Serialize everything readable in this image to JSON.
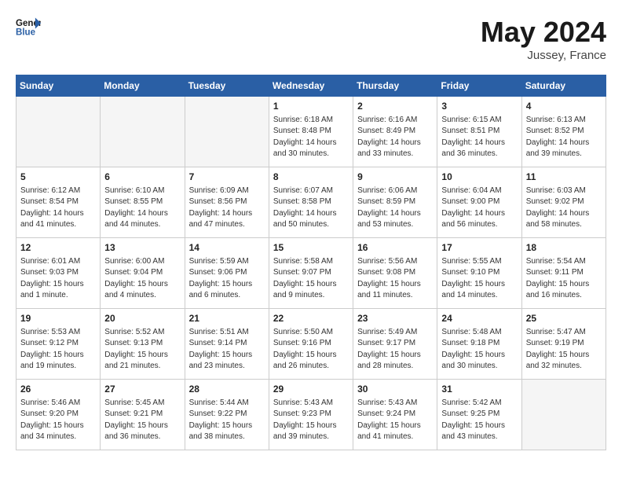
{
  "header": {
    "logo_general": "General",
    "logo_blue": "Blue",
    "month": "May 2024",
    "location": "Jussey, France"
  },
  "days_of_week": [
    "Sunday",
    "Monday",
    "Tuesday",
    "Wednesday",
    "Thursday",
    "Friday",
    "Saturday"
  ],
  "weeks": [
    [
      {
        "day": "",
        "data": ""
      },
      {
        "day": "",
        "data": ""
      },
      {
        "day": "",
        "data": ""
      },
      {
        "day": "1",
        "data": "Sunrise: 6:18 AM\nSunset: 8:48 PM\nDaylight: 14 hours\nand 30 minutes."
      },
      {
        "day": "2",
        "data": "Sunrise: 6:16 AM\nSunset: 8:49 PM\nDaylight: 14 hours\nand 33 minutes."
      },
      {
        "day": "3",
        "data": "Sunrise: 6:15 AM\nSunset: 8:51 PM\nDaylight: 14 hours\nand 36 minutes."
      },
      {
        "day": "4",
        "data": "Sunrise: 6:13 AM\nSunset: 8:52 PM\nDaylight: 14 hours\nand 39 minutes."
      }
    ],
    [
      {
        "day": "5",
        "data": "Sunrise: 6:12 AM\nSunset: 8:54 PM\nDaylight: 14 hours\nand 41 minutes."
      },
      {
        "day": "6",
        "data": "Sunrise: 6:10 AM\nSunset: 8:55 PM\nDaylight: 14 hours\nand 44 minutes."
      },
      {
        "day": "7",
        "data": "Sunrise: 6:09 AM\nSunset: 8:56 PM\nDaylight: 14 hours\nand 47 minutes."
      },
      {
        "day": "8",
        "data": "Sunrise: 6:07 AM\nSunset: 8:58 PM\nDaylight: 14 hours\nand 50 minutes."
      },
      {
        "day": "9",
        "data": "Sunrise: 6:06 AM\nSunset: 8:59 PM\nDaylight: 14 hours\nand 53 minutes."
      },
      {
        "day": "10",
        "data": "Sunrise: 6:04 AM\nSunset: 9:00 PM\nDaylight: 14 hours\nand 56 minutes."
      },
      {
        "day": "11",
        "data": "Sunrise: 6:03 AM\nSunset: 9:02 PM\nDaylight: 14 hours\nand 58 minutes."
      }
    ],
    [
      {
        "day": "12",
        "data": "Sunrise: 6:01 AM\nSunset: 9:03 PM\nDaylight: 15 hours\nand 1 minute."
      },
      {
        "day": "13",
        "data": "Sunrise: 6:00 AM\nSunset: 9:04 PM\nDaylight: 15 hours\nand 4 minutes."
      },
      {
        "day": "14",
        "data": "Sunrise: 5:59 AM\nSunset: 9:06 PM\nDaylight: 15 hours\nand 6 minutes."
      },
      {
        "day": "15",
        "data": "Sunrise: 5:58 AM\nSunset: 9:07 PM\nDaylight: 15 hours\nand 9 minutes."
      },
      {
        "day": "16",
        "data": "Sunrise: 5:56 AM\nSunset: 9:08 PM\nDaylight: 15 hours\nand 11 minutes."
      },
      {
        "day": "17",
        "data": "Sunrise: 5:55 AM\nSunset: 9:10 PM\nDaylight: 15 hours\nand 14 minutes."
      },
      {
        "day": "18",
        "data": "Sunrise: 5:54 AM\nSunset: 9:11 PM\nDaylight: 15 hours\nand 16 minutes."
      }
    ],
    [
      {
        "day": "19",
        "data": "Sunrise: 5:53 AM\nSunset: 9:12 PM\nDaylight: 15 hours\nand 19 minutes."
      },
      {
        "day": "20",
        "data": "Sunrise: 5:52 AM\nSunset: 9:13 PM\nDaylight: 15 hours\nand 21 minutes."
      },
      {
        "day": "21",
        "data": "Sunrise: 5:51 AM\nSunset: 9:14 PM\nDaylight: 15 hours\nand 23 minutes."
      },
      {
        "day": "22",
        "data": "Sunrise: 5:50 AM\nSunset: 9:16 PM\nDaylight: 15 hours\nand 26 minutes."
      },
      {
        "day": "23",
        "data": "Sunrise: 5:49 AM\nSunset: 9:17 PM\nDaylight: 15 hours\nand 28 minutes."
      },
      {
        "day": "24",
        "data": "Sunrise: 5:48 AM\nSunset: 9:18 PM\nDaylight: 15 hours\nand 30 minutes."
      },
      {
        "day": "25",
        "data": "Sunrise: 5:47 AM\nSunset: 9:19 PM\nDaylight: 15 hours\nand 32 minutes."
      }
    ],
    [
      {
        "day": "26",
        "data": "Sunrise: 5:46 AM\nSunset: 9:20 PM\nDaylight: 15 hours\nand 34 minutes."
      },
      {
        "day": "27",
        "data": "Sunrise: 5:45 AM\nSunset: 9:21 PM\nDaylight: 15 hours\nand 36 minutes."
      },
      {
        "day": "28",
        "data": "Sunrise: 5:44 AM\nSunset: 9:22 PM\nDaylight: 15 hours\nand 38 minutes."
      },
      {
        "day": "29",
        "data": "Sunrise: 5:43 AM\nSunset: 9:23 PM\nDaylight: 15 hours\nand 39 minutes."
      },
      {
        "day": "30",
        "data": "Sunrise: 5:43 AM\nSunset: 9:24 PM\nDaylight: 15 hours\nand 41 minutes."
      },
      {
        "day": "31",
        "data": "Sunrise: 5:42 AM\nSunset: 9:25 PM\nDaylight: 15 hours\nand 43 minutes."
      },
      {
        "day": "",
        "data": ""
      }
    ]
  ]
}
